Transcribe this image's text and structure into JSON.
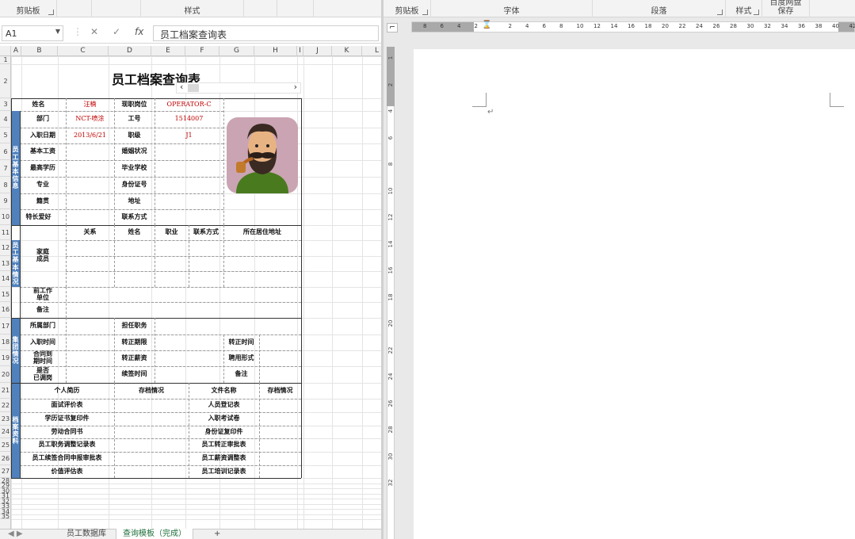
{
  "excel": {
    "ribbon": {
      "groups": [
        {
          "label": "剪贴板"
        },
        {
          "label": "样式"
        }
      ]
    },
    "namebox": "A1",
    "formula_icons": {
      "cancel": "✕",
      "confirm": "✓",
      "fx": "fx"
    },
    "formula_content": "员工档案查询表",
    "columns": [
      "A",
      "B",
      "C",
      "D",
      "E",
      "F",
      "G",
      "H",
      "I",
      "J",
      "K",
      "L"
    ],
    "rows": [
      "1",
      "2",
      "3",
      "4",
      "5",
      "6",
      "7",
      "8",
      "9",
      "10",
      "11",
      "12",
      "13",
      "14",
      "15",
      "16",
      "17",
      "18",
      "19",
      "20",
      "21",
      "22",
      "23",
      "24",
      "25",
      "26",
      "27",
      "28",
      "29",
      "30",
      "31",
      "32",
      "33",
      "34",
      "35"
    ],
    "form": {
      "title": "员工档案查询表",
      "name_label": "姓名",
      "name_value": "汪楠",
      "position_label": "现职岗位",
      "position_value": "OPERATOR-C",
      "dept_label": "部门",
      "dept_value": "NCT-喷涂",
      "id_label": "工号",
      "id_value": "1514007",
      "hire_label": "入职日期",
      "hire_value": "2013/6/21",
      "level_label": "职级",
      "level_value": "J1",
      "sec_basic": "员工\n基本\n信息",
      "salary_label": "基本工资",
      "marital_label": "婚姻状况",
      "edu_label": "最高学历",
      "school_label": "毕业学校",
      "major_label": "专业",
      "idcard_label": "身份证号",
      "origin_label": "籍贯",
      "address_label": "地址",
      "hobby_label": "特长爱好",
      "contact_label": "联系方式",
      "sec_status": "员工\n基本\n情况",
      "family_label": "家庭\n成员",
      "fam_rel": "关系",
      "fam_name": "姓名",
      "fam_job": "职业",
      "fam_contact": "联系方式",
      "fam_addr": "所在居住地址",
      "prev_label": "前工作\n单位",
      "remark_label": "备注",
      "sec_career": "集团\n情况",
      "cur_dept": "所属部门",
      "cur_role": "担任职务",
      "join_time": "入职时间",
      "probation": "转正期限",
      "regular_time": "转正时间",
      "contract_time": "合同到\n期时间",
      "regular_salary": "转正薪资",
      "hire_form": "聘用形式",
      "resign": "是否\n已调岗",
      "renew_time": "续签时间",
      "remark2": "备注",
      "sec_archive": "档案\n资料",
      "arch_resume": "个人简历",
      "arch_status": "存档情况",
      "arch_file": "文件名称",
      "arch_status2": "存档情况",
      "arch_left": [
        "面试评价表",
        "学历证书复印件",
        "劳动合同书",
        "员工职务调整记录表",
        "员工续签合同申报审批表",
        "价值评估表"
      ],
      "arch_right": [
        "人员登记表",
        "入职考试卷",
        "身份证复印件",
        "员工转正审批表",
        "员工薪资调整表",
        "员工培训记录表"
      ]
    },
    "sheet_tabs": [
      "员工数据库",
      "查询模板（完成）"
    ],
    "sheet_add": "+"
  },
  "word": {
    "ribbon": {
      "groups": [
        {
          "label": "剪贴板"
        },
        {
          "label": "字体"
        },
        {
          "label": "段落"
        },
        {
          "label": "样式"
        },
        {
          "label": "保存"
        }
      ],
      "top_partial": "百度网盘"
    },
    "ruler_numbers": [
      "8",
      "6",
      "4",
      "2",
      "",
      "2",
      "4",
      "6",
      "8",
      "10",
      "12",
      "14",
      "16",
      "18",
      "20",
      "22",
      "24",
      "26",
      "28",
      "30",
      "32",
      "34",
      "36",
      "38",
      "40",
      "42"
    ],
    "vruler_numbers": [
      "1",
      "2",
      "4",
      "6",
      "8",
      "10",
      "12",
      "14",
      "16",
      "18",
      "20",
      "22",
      "24",
      "26",
      "28",
      "30",
      "32"
    ],
    "paragraph_mark": "↵"
  },
  "colors": {
    "section_blue": "#4f81bd",
    "value_red": "#c00000"
  }
}
